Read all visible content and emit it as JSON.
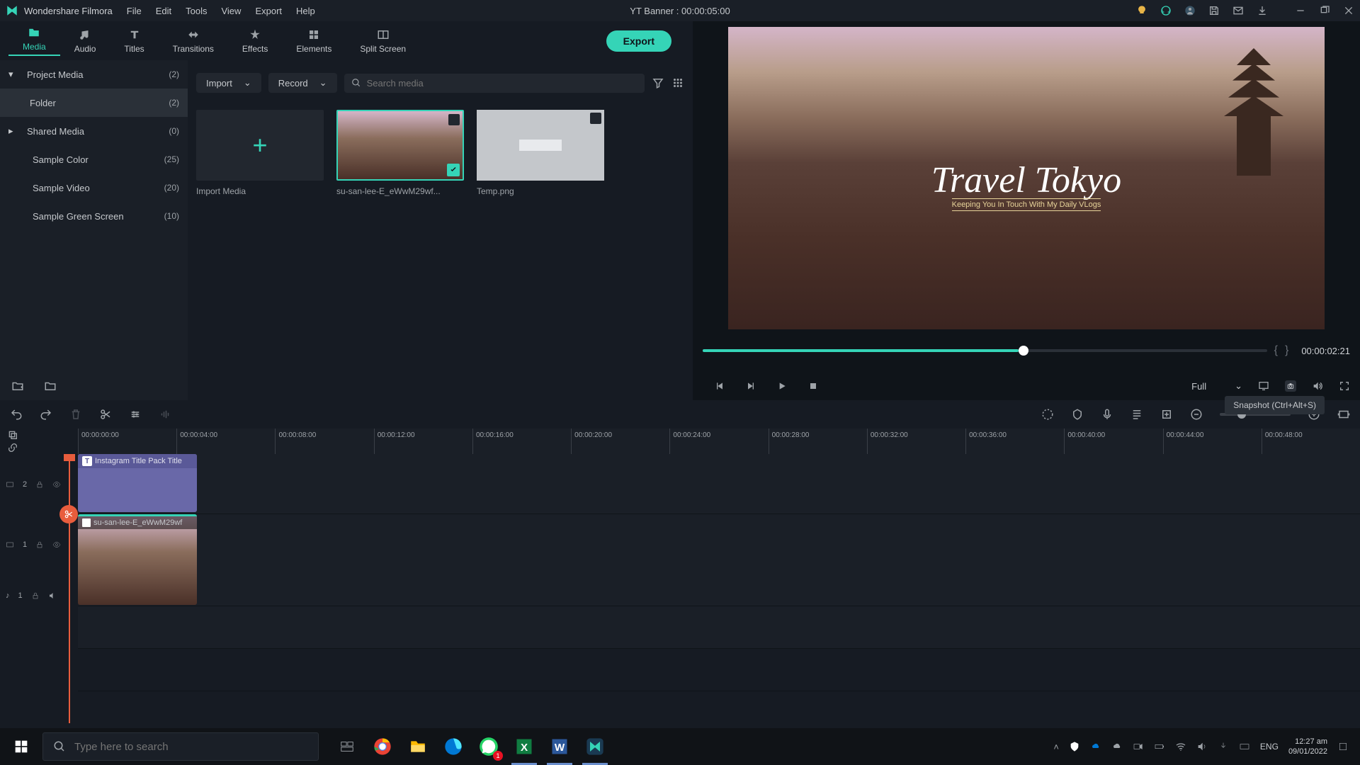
{
  "titlebar": {
    "app_name": "Wondershare Filmora",
    "menu": [
      "File",
      "Edit",
      "Tools",
      "View",
      "Export",
      "Help"
    ],
    "project_title": "YT Banner : 00:00:05:00"
  },
  "tabs": [
    {
      "label": "Media",
      "active": true
    },
    {
      "label": "Audio",
      "active": false
    },
    {
      "label": "Titles",
      "active": false
    },
    {
      "label": "Transitions",
      "active": false
    },
    {
      "label": "Effects",
      "active": false
    },
    {
      "label": "Elements",
      "active": false
    },
    {
      "label": "Split Screen",
      "active": false
    }
  ],
  "export_button": "Export",
  "sidebar": {
    "items": [
      {
        "label": "Project Media",
        "count": "(2)",
        "expanded": true
      },
      {
        "label": "Folder",
        "count": "(2)",
        "selected": true,
        "indent": true
      },
      {
        "label": "Shared Media",
        "count": "(0)",
        "arrow": true
      },
      {
        "label": "Sample Color",
        "count": "(25)"
      },
      {
        "label": "Sample Video",
        "count": "(20)"
      },
      {
        "label": "Sample Green Screen",
        "count": "(10)"
      }
    ]
  },
  "media_toolbar": {
    "import": "Import",
    "record": "Record",
    "search_placeholder": "Search media"
  },
  "media_items": [
    {
      "label": "Import Media",
      "type": "import"
    },
    {
      "label": "su-san-lee-E_eWwM29wf...",
      "type": "image",
      "selected": true
    },
    {
      "label": "Temp.png",
      "type": "temp"
    }
  ],
  "preview": {
    "title": "Travel Tokyo",
    "subtitle": "Keeping You In Touch With My Daily VLogs",
    "timecode": "00:00:02:21",
    "quality": "Full"
  },
  "timeline": {
    "tooltip": "Snapshot (Ctrl+Alt+S)",
    "labels": [
      "00:00:00:00",
      "00:00:04:00",
      "00:00:08:00",
      "00:00:12:00",
      "00:00:16:00",
      "00:00:20:00",
      "00:00:24:00",
      "00:00:28:00",
      "00:00:32:00",
      "00:00:36:00",
      "00:00:40:00",
      "00:00:44:00",
      "00:00:48:00"
    ],
    "tracks": {
      "title_track": "2",
      "video_track": "1",
      "audio_track": "1",
      "title_clip": "Instagram Title Pack Title",
      "video_clip": "su-san-lee-E_eWwM29wf"
    }
  },
  "taskbar": {
    "search_placeholder": "Type here to search",
    "lang": "ENG",
    "time": "12:27 am",
    "date": "09/01/2022"
  }
}
